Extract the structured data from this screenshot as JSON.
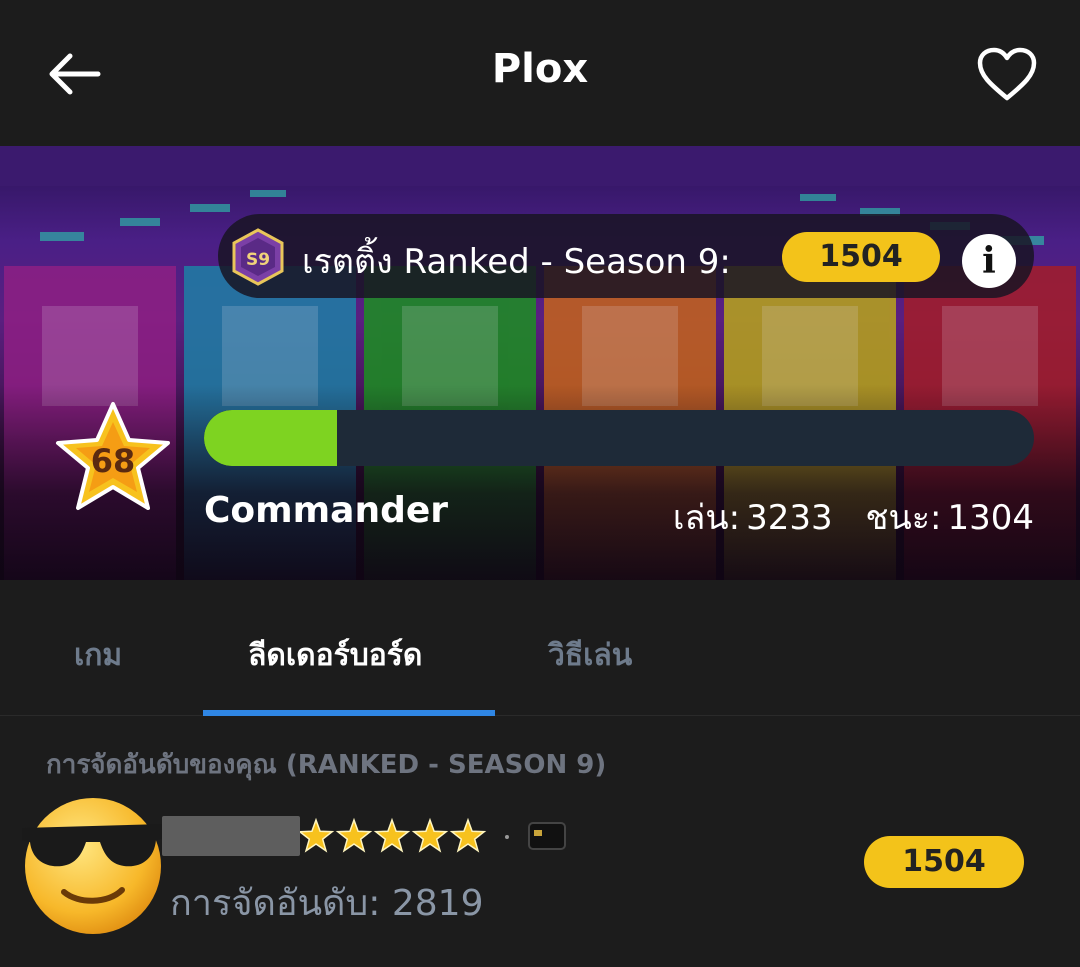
{
  "header": {
    "title": "Plox"
  },
  "banner": {
    "rating_label": "เรตติ้ง Ranked - Season 9:",
    "rating_value": "1504",
    "info_glyph": "i",
    "season_badge_icon": "season-9-badge-icon",
    "level": "68",
    "xp_progress": 0.16,
    "rank_name": "Commander",
    "played_label": "เล่น:",
    "played_value": "3233",
    "wins_label": "ชนะ:",
    "wins_value": "1304",
    "tile_colors": [
      "#8e1f84",
      "#1e7fa6",
      "#1c8f22",
      "#c5641c",
      "#b8a51c",
      "#a31d2a"
    ]
  },
  "tabs": [
    {
      "label": "เกม",
      "active": false
    },
    {
      "label": "ลีดเดอร์บอร์ด",
      "active": true
    },
    {
      "label": "วิธีเล่น",
      "active": false
    }
  ],
  "ranking": {
    "section_title": "การจัดอันดับของคุณ (RANKED - SEASON 9)",
    "avatar_icon": "sunglasses-emoji-icon",
    "star_count": 5,
    "rank_label": "การจัดอันดับ:",
    "rank_value": "2819",
    "score": "1504"
  },
  "colors": {
    "accent_yellow": "#f3c31a",
    "tab_underline": "#2f86e4",
    "xp_fill": "#7ed321",
    "background": "#1c1c1c"
  }
}
